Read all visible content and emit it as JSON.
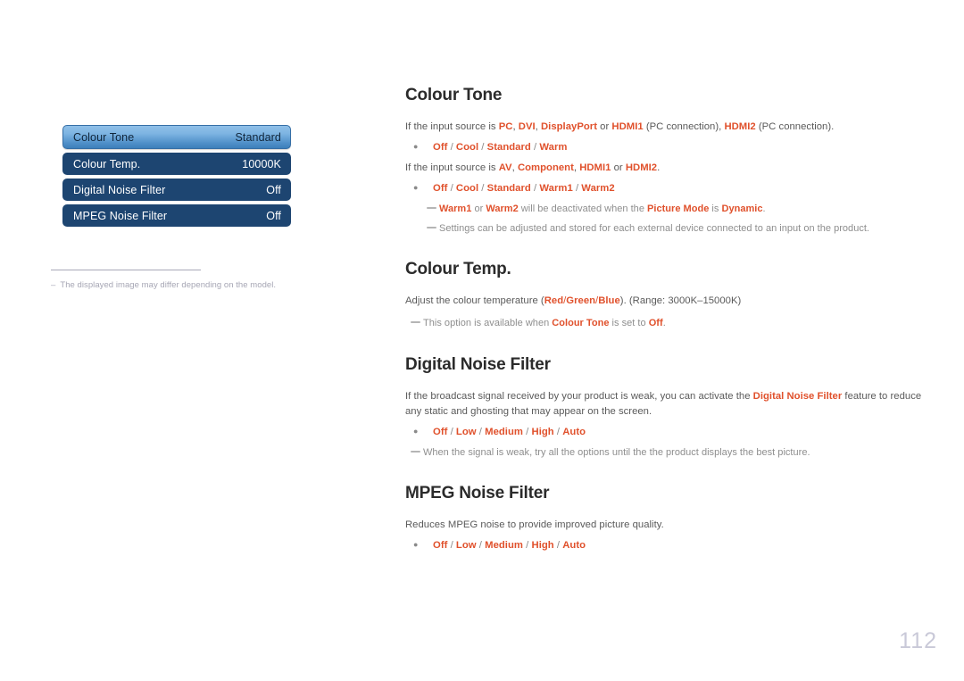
{
  "osd_menu": {
    "rows": [
      {
        "label": "Colour Tone",
        "value": "Standard",
        "selected": true
      },
      {
        "label": "Colour Temp.",
        "value": "10000K",
        "selected": false
      },
      {
        "label": "Digital Noise Filter",
        "value": "Off",
        "selected": false
      },
      {
        "label": "MPEG Noise Filter",
        "value": "Off",
        "selected": false
      }
    ]
  },
  "left_note": {
    "dash": "–",
    "text": "The displayed image may differ depending on the model."
  },
  "sections": {
    "colour_tone": {
      "title": "Colour Tone",
      "para1_a": "If the input source is ",
      "para1_pc": "PC",
      "para1_c1": ", ",
      "para1_dvi": "DVI",
      "para1_c2": ", ",
      "para1_dp": "DisplayPort",
      "para1_or": " or ",
      "para1_hdmi1": "HDMI1",
      "para1_pcconn1": " (PC connection), ",
      "para1_hdmi2": "HDMI2",
      "para1_pcconn2": " (PC connection).",
      "options1": [
        "Off",
        "Cool",
        "Standard",
        "Warm"
      ],
      "para2_a": "If the input source is ",
      "para2_av": "AV",
      "para2_c1": ", ",
      "para2_comp": "Component",
      "para2_c2": ", ",
      "para2_hdmi1": "HDMI1",
      "para2_or": " or ",
      "para2_hdmi2": "HDMI2",
      "para2_end": ".",
      "options2": [
        "Off",
        "Cool",
        "Standard",
        "Warm1",
        "Warm2"
      ],
      "note1_warm1": "Warm1",
      "note1_or": " or ",
      "note1_warm2": "Warm2",
      "note1_mid": " will be deactivated when the ",
      "note1_picmode": "Picture Mode",
      "note1_is": " is ",
      "note1_dynamic": "Dynamic",
      "note1_end": ".",
      "note2": "Settings can be adjusted and stored for each external device connected to an input on the product."
    },
    "colour_temp": {
      "title": "Colour Temp.",
      "para_a": "Adjust the colour temperature (",
      "para_red": "Red",
      "para_s1": "/",
      "para_green": "Green",
      "para_s2": "/",
      "para_blue": "Blue",
      "para_b": "). (Range: 3000K–15000K)",
      "note_a": "This option is available when ",
      "note_colourtone": "Colour Tone",
      "note_b": " is set to ",
      "note_off": "Off",
      "note_c": "."
    },
    "digital_noise_filter": {
      "title": "Digital Noise Filter",
      "para_a": "If the broadcast signal received by your product is weak, you can activate the ",
      "para_dnf": "Digital Noise Filter",
      "para_b": " feature to reduce any static and ghosting that may appear on the screen.",
      "options": [
        "Off",
        "Low",
        "Medium",
        "High",
        "Auto"
      ],
      "note": "When the signal is weak, try all the options until the the product displays the best picture."
    },
    "mpeg_noise_filter": {
      "title": "MPEG Noise Filter",
      "para": "Reduces MPEG noise to provide improved picture quality.",
      "options": [
        "Off",
        "Low",
        "Medium",
        "High",
        "Auto"
      ]
    }
  },
  "page_number": "112",
  "colors": {
    "accent_orange": "#e0512c",
    "menu_navy": "#1d4571",
    "menu_selected_top": "#8fc0e8",
    "menu_selected_bottom": "#3d7fba",
    "body_text": "#5a5a5a",
    "note_text": "#8e8e8e",
    "page_number": "#c9c9d8"
  }
}
